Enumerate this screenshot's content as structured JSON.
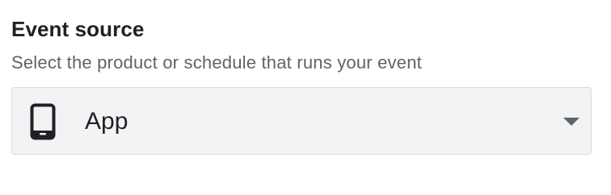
{
  "event_source": {
    "title": "Event source",
    "description": "Select the product or schedule that runs your event",
    "select": {
      "selected_value": "App",
      "icon": "smartphone-icon",
      "arrow_icon": "dropdown-arrow-icon"
    }
  },
  "colors": {
    "select_background": "#f1f3f4",
    "select_border": "#dadce0",
    "title_text": "#202124",
    "description_text": "#5f6368",
    "icon": "#202124",
    "arrow": "#5f6368"
  }
}
